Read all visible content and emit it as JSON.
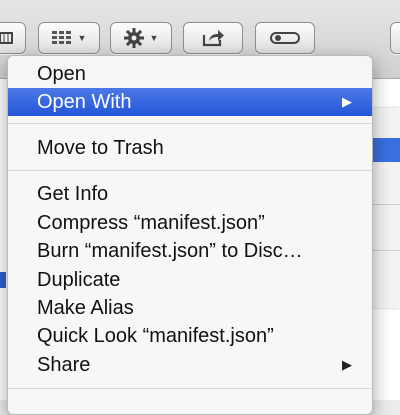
{
  "toolbar": {
    "view_button_icon": "grid-view-icon",
    "action_button_icon": "gear-icon",
    "share_button_icon": "share-icon",
    "tag_button_icon": "toggle-icon"
  },
  "menu": {
    "open": "Open",
    "open_with": "Open With",
    "move_to_trash": "Move to Trash",
    "get_info": "Get Info",
    "compress": "Compress “manifest.json”",
    "burn": "Burn “manifest.json” to Disc…",
    "duplicate": "Duplicate",
    "make_alias": "Make Alias",
    "quick_look": "Quick Look “manifest.json”",
    "share": "Share"
  },
  "colors": {
    "highlight": "#2456d8",
    "menu_bg": "#f7f7f7"
  }
}
